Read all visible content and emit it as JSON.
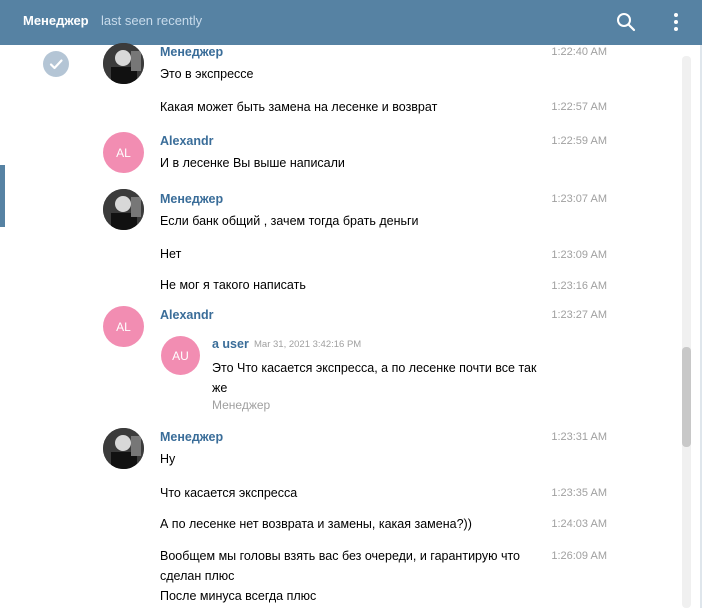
{
  "header": {
    "name": "Менеджер",
    "status": "last seen recently",
    "icons": [
      "search-icon",
      "more-vertical-icon"
    ]
  },
  "colors": {
    "header_bg": "#5682a3",
    "author": "#3a6d99",
    "avatar_pink": "#f28db2",
    "timestamp": "#a0a0a0"
  },
  "messages": [
    {
      "author": "Менеджер",
      "text": "Это в экспрессе",
      "time": "1:22:40 AM"
    },
    {
      "text": "Какая может быть замена на лесенке и возврат",
      "time": "1:22:57 AM"
    },
    {
      "author": "Alexandr",
      "avatar": "AL",
      "text": "И в лесенке Вы выше написали",
      "time": "1:22:59 AM"
    },
    {
      "author": "Менеджер",
      "text": "Если банк общий , зачем тогда брать деньги",
      "time": "1:23:07 AM"
    },
    {
      "text": "Нет",
      "time": "1:23:09 AM"
    },
    {
      "text": "Не мог я такого написать",
      "time": "1:23:16 AM"
    },
    {
      "author": "Alexandr",
      "avatar": "AL",
      "time": "1:23:27 AM",
      "forward": {
        "avatar": "AU",
        "author": "a user",
        "date": "Mar 31, 2021 3:42:16 PM",
        "text": "Это Что касается экспресса, а по лесенке  почти все так же",
        "signature": "Менеджер"
      }
    },
    {
      "author": "Менеджер",
      "text": "Ну",
      "time": "1:23:31 AM"
    },
    {
      "text": "Что касается экспресса",
      "time": "1:23:35 AM"
    },
    {
      "text": "А по лесенке нет возврата и замены, какая замена?))",
      "time": "1:24:03 AM"
    },
    {
      "text_lines": [
        "Вообщем мы головы взять вас без очереди, и гарантирую что",
        "сделан плюс",
        "После минуса всегда плюс"
      ],
      "time": "1:26:09 AM"
    }
  ]
}
